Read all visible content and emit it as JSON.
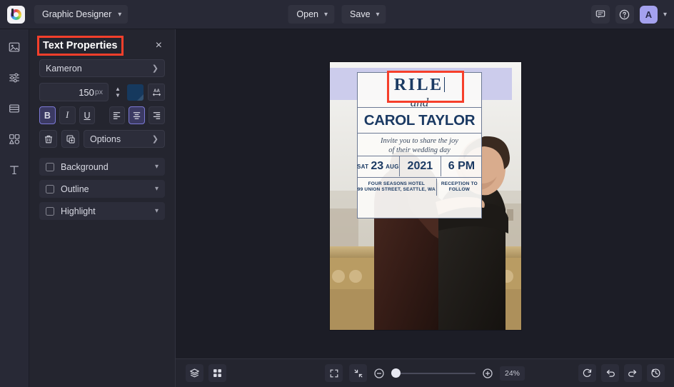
{
  "app": {
    "brand_icon": "colorwheel-logo-icon",
    "doc_menu_label": "Graphic Designer",
    "open_label": "Open",
    "save_label": "Save",
    "avatar_initial": "A",
    "accent_purple": "#7c79d6",
    "highlight_red": "#f63f2b",
    "panel_bg": "#24252f",
    "workspace_bg": "#1c1d26"
  },
  "rail": {
    "items": [
      {
        "name": "image-icon",
        "label": "Image"
      },
      {
        "name": "adjustments-icon",
        "label": "Adjust"
      },
      {
        "name": "layout-icon",
        "label": "Layout"
      },
      {
        "name": "shapes-icon",
        "label": "Elements"
      },
      {
        "name": "text-icon",
        "label": "Text"
      }
    ]
  },
  "panel": {
    "title": "Text Properties",
    "close_label": "×",
    "font_family": "Kameron",
    "font_size": "150",
    "font_size_unit": "px",
    "text_color": "#16395e",
    "letter_spacing_icon": "letter-spacing-icon",
    "style_buttons": [
      {
        "name": "bold-button",
        "label": "B",
        "active": true
      },
      {
        "name": "italic-button",
        "label": "I",
        "active": false
      },
      {
        "name": "underline-button",
        "label": "U",
        "active": false
      }
    ],
    "align_buttons": [
      {
        "name": "align-left-button",
        "active": false
      },
      {
        "name": "align-center-button",
        "active": true
      },
      {
        "name": "align-right-button",
        "active": false
      }
    ],
    "delete_label": "trash-icon",
    "duplicate_label": "duplicate-icon",
    "options_label": "Options",
    "sections": [
      {
        "label": "Background",
        "checked": false
      },
      {
        "label": "Outline",
        "checked": false
      },
      {
        "label": "Highlight",
        "checked": false
      }
    ]
  },
  "canvas": {
    "invitation": {
      "name_first": "RILE",
      "connector": "and",
      "name_second": "CAROL TAYLOR",
      "invite_line_1": "Invite you to share the joy",
      "invite_line_2": "of their wedding day",
      "day": "SAT",
      "day_number": "23",
      "month": "AUG",
      "year": "2021",
      "time": "6 PM",
      "venue_line_1": "FOUR SEASONS HOTEL",
      "venue_line_2": "99 UNION STREET, SEATTLE, WA",
      "reception_line_1": "RECEPTION TO",
      "reception_line_2": "FOLLOW",
      "ink_color": "#1b3a63",
      "selection_color": "#ccccec"
    }
  },
  "bottombar": {
    "layers_label": "layers-icon",
    "grid_label": "grid-icon",
    "fit_label": "fit-screen-icon",
    "shrink_label": "shrink-icon",
    "zoom_out_label": "zoom-out-icon",
    "zoom_in_label": "zoom-in-icon",
    "zoom_value": "24%",
    "reset_label": "reset-icon",
    "undo_label": "undo-icon",
    "redo_label": "redo-icon",
    "history_label": "history-icon"
  }
}
